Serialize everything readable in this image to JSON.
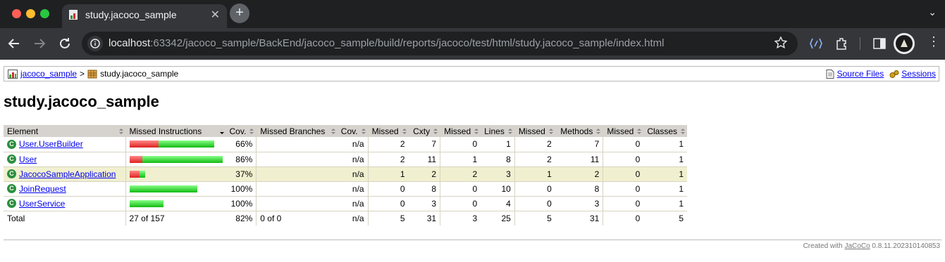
{
  "browser": {
    "tab_title": "study.jacoco_sample",
    "url_host": "localhost",
    "url_rest": ":63342/jacoco_sample/BackEnd/jacoco_sample/build/reports/jacoco/test/html/study.jacoco_sample/index.html"
  },
  "breadcrumb": {
    "root": "jacoco_sample",
    "sep": ">",
    "current": "study.jacoco_sample",
    "source_files": "Source Files",
    "sessions": "Sessions"
  },
  "page_title": "study.jacoco_sample",
  "table": {
    "headers": [
      "Element",
      "Missed Instructions",
      "Cov.",
      "Missed Branches",
      "Cov.",
      "Missed",
      "Cxty",
      "Missed",
      "Lines",
      "Missed",
      "Methods",
      "Missed",
      "Classes"
    ],
    "rows": [
      {
        "name": "User.UserBuilder",
        "missed_frac": 0.34,
        "scale": 1.0,
        "cov": "66%",
        "br_cov": "n/a",
        "cxty_missed": "2",
        "cxty": "7",
        "lines_missed": "0",
        "lines": "1",
        "meth_missed": "2",
        "meth": "7",
        "cls_missed": "0",
        "cls": "1"
      },
      {
        "name": "User",
        "missed_frac": 0.14,
        "scale": 1.1,
        "cov": "86%",
        "br_cov": "n/a",
        "cxty_missed": "2",
        "cxty": "11",
        "lines_missed": "1",
        "lines": "8",
        "meth_missed": "2",
        "meth": "11",
        "cls_missed": "0",
        "cls": "1"
      },
      {
        "name": "JacocoSampleApplication",
        "missed_frac": 0.63,
        "scale": 0.18,
        "cov": "37%",
        "br_cov": "n/a",
        "cxty_missed": "1",
        "cxty": "2",
        "lines_missed": "2",
        "lines": "3",
        "meth_missed": "1",
        "meth": "2",
        "cls_missed": "0",
        "cls": "1"
      },
      {
        "name": "JoinRequest",
        "missed_frac": 0.0,
        "scale": 0.8,
        "cov": "100%",
        "br_cov": "n/a",
        "cxty_missed": "0",
        "cxty": "8",
        "lines_missed": "0",
        "lines": "10",
        "meth_missed": "0",
        "meth": "8",
        "cls_missed": "0",
        "cls": "1"
      },
      {
        "name": "UserService",
        "missed_frac": 0.0,
        "scale": 0.4,
        "cov": "100%",
        "br_cov": "n/a",
        "cxty_missed": "0",
        "cxty": "3",
        "lines_missed": "0",
        "lines": "4",
        "meth_missed": "0",
        "meth": "3",
        "cls_missed": "0",
        "cls": "1"
      }
    ],
    "total": {
      "label": "Total",
      "instr": "27 of 157",
      "cov": "82%",
      "br": "0 of 0",
      "br_cov": "n/a",
      "cxty_missed": "5",
      "cxty": "31",
      "lines_missed": "3",
      "lines": "25",
      "meth_missed": "5",
      "meth": "31",
      "cls_missed": "0",
      "cls": "5"
    }
  },
  "footer": {
    "prefix": "Created with",
    "link": "JaCoCo",
    "version": "0.8.11.202310140853"
  }
}
